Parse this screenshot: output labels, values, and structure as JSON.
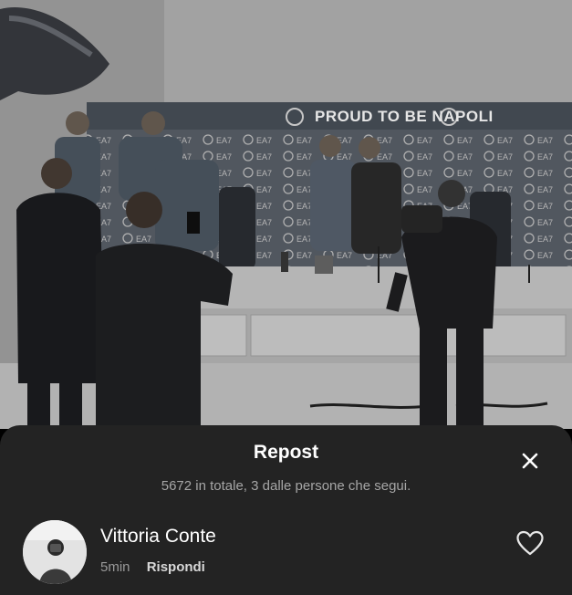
{
  "video": {
    "backdrop_text": "PROUD TO BE NAPOLI",
    "sponsor_text": "EA7"
  },
  "sheet": {
    "title": "Repost",
    "subtitle": "5672 in totale, 3 dalle persone che segui.",
    "close_icon": "close-icon"
  },
  "comment": {
    "username": "Vittoria Conte",
    "time": "5min",
    "reply_label": "Rispondi",
    "like_icon": "heart-outline-icon"
  },
  "colors": {
    "sheet_background": "#232323",
    "title_text": "#ffffff",
    "subtitle_text": "#a6a6a6",
    "time_text": "#9a9a9a"
  }
}
